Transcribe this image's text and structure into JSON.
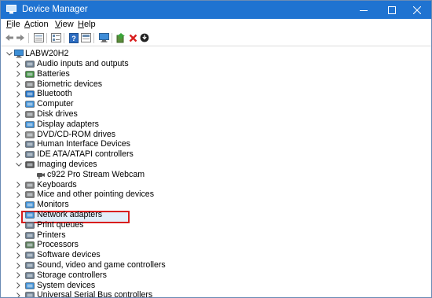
{
  "window": {
    "title": "Device Manager"
  },
  "menu": [
    {
      "label": "File",
      "ul": "F",
      "rest": "ile"
    },
    {
      "label": "Action",
      "ul": "A",
      "rest": "ction"
    },
    {
      "label": "View",
      "ul": "V",
      "rest": "iew"
    },
    {
      "label": "Help",
      "ul": "H",
      "rest": "elp"
    }
  ],
  "toolbar": [
    "back-arrow-icon",
    "forward-arrow-icon",
    "show-hidden-icon",
    "properties-icon",
    "help-icon",
    "display-icon",
    "update-driver-icon",
    "uninstall-icon",
    "download-icon"
  ],
  "tree": {
    "root": "LABW20H2",
    "categories": [
      {
        "label": "Audio inputs and outputs",
        "icon": "speaker-icon",
        "color": "#6b7d8f"
      },
      {
        "label": "Batteries",
        "icon": "battery-icon",
        "color": "#3f8d3f"
      },
      {
        "label": "Biometric devices",
        "icon": "fingerprint-icon",
        "color": "#7a7a7a"
      },
      {
        "label": "Bluetooth",
        "icon": "bluetooth-icon",
        "color": "#1e6fc4"
      },
      {
        "label": "Computer",
        "icon": "computer-icon",
        "color": "#3d8fd6"
      },
      {
        "label": "Disk drives",
        "icon": "disk-drive-icon",
        "color": "#7a7a7a"
      },
      {
        "label": "Display adapters",
        "icon": "display-adapter-icon",
        "color": "#3d8fd6"
      },
      {
        "label": "DVD/CD-ROM drives",
        "icon": "dvd-icon",
        "color": "#8a8a8a"
      },
      {
        "label": "Human Interface Devices",
        "icon": "hid-icon",
        "color": "#6b7d8f"
      },
      {
        "label": "IDE ATA/ATAPI controllers",
        "icon": "ide-controller-icon",
        "color": "#6b7d8f"
      },
      {
        "label": "Imaging devices",
        "icon": "camera-icon",
        "color": "#555555",
        "expanded": true,
        "children": [
          {
            "label": "c922 Pro Stream Webcam",
            "icon": "webcam-icon",
            "selected": true
          }
        ]
      },
      {
        "label": "Keyboards",
        "icon": "keyboard-icon",
        "color": "#7a7a7a"
      },
      {
        "label": "Mice and other pointing devices",
        "icon": "mouse-icon",
        "color": "#7a7a7a"
      },
      {
        "label": "Monitors",
        "icon": "monitor-icon",
        "color": "#3d8fd6"
      },
      {
        "label": "Network adapters",
        "icon": "network-adapter-icon",
        "color": "#3d8fd6"
      },
      {
        "label": "Print queues",
        "icon": "print-queue-icon",
        "color": "#6b7d8f"
      },
      {
        "label": "Printers",
        "icon": "printer-icon",
        "color": "#6b7d8f"
      },
      {
        "label": "Processors",
        "icon": "processor-icon",
        "color": "#5a7a5a"
      },
      {
        "label": "Software devices",
        "icon": "software-device-icon",
        "color": "#6b7d8f"
      },
      {
        "label": "Sound, video and game controllers",
        "icon": "sound-icon",
        "color": "#6b7d8f"
      },
      {
        "label": "Storage controllers",
        "icon": "storage-controller-icon",
        "color": "#6b7d8f"
      },
      {
        "label": "System devices",
        "icon": "system-device-icon",
        "color": "#3d8fd6"
      },
      {
        "label": "Universal Serial Bus controllers",
        "icon": "usb-icon",
        "color": "#6b7d8f"
      }
    ]
  }
}
